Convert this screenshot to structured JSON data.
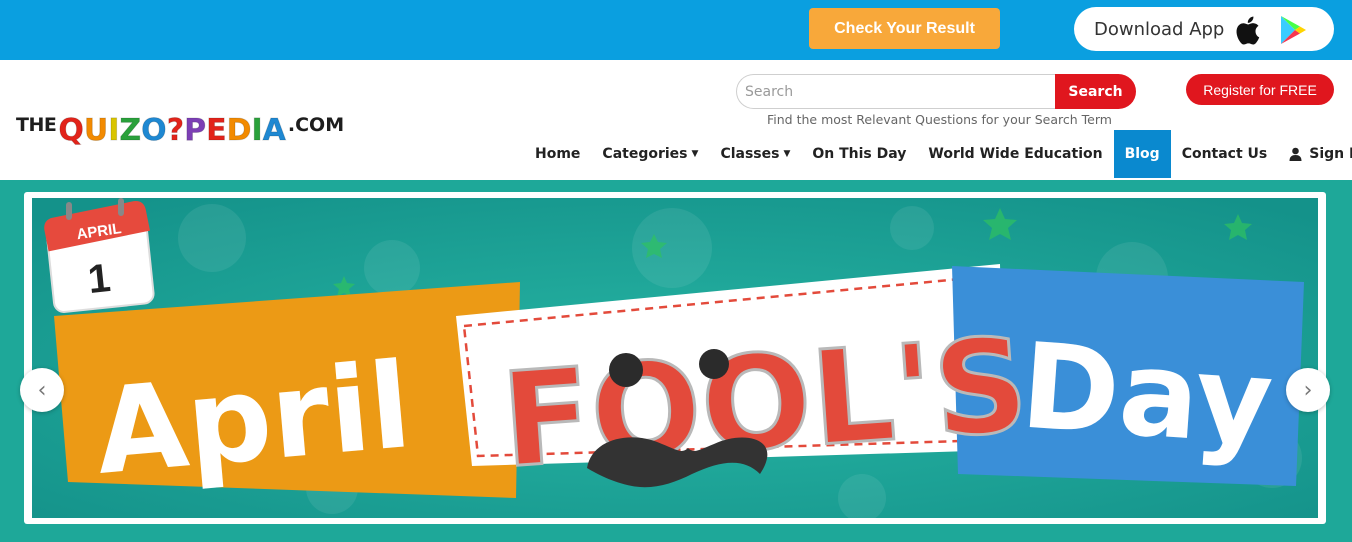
{
  "topbar": {
    "check_result_label": "Check Your Result",
    "download_app_label": "Download App",
    "icons": [
      "apple-icon",
      "google-play-icon"
    ],
    "colors": {
      "bar": "#0a9fe0",
      "check_button": "#f8a83a"
    }
  },
  "header": {
    "logo": {
      "prefix": "THE",
      "letters": [
        "Q",
        "U",
        "I",
        "Z",
        "O",
        "?",
        "P",
        "E",
        "D",
        "I",
        "A"
      ],
      "suffix": ".COM"
    },
    "search": {
      "placeholder": "Search",
      "button_label": "Search",
      "hint": "Find the most Relevant Questions for your Search Term"
    },
    "register_label": "Register for FREE"
  },
  "nav": {
    "items": [
      {
        "label": "Home",
        "dropdown": false
      },
      {
        "label": "Categories",
        "dropdown": true
      },
      {
        "label": "Classes",
        "dropdown": true
      },
      {
        "label": "On This Day",
        "dropdown": false
      },
      {
        "label": "World Wide Education",
        "dropdown": false
      },
      {
        "label": "Blog",
        "dropdown": false,
        "active": true
      },
      {
        "label": "Contact Us",
        "dropdown": false
      },
      {
        "label": "Sign In",
        "dropdown": true,
        "icon": "user-icon"
      }
    ]
  },
  "banner": {
    "calendar_month": "APRIL",
    "calendar_day": "1",
    "word1": "April",
    "word2": "FOOL'S",
    "word3": "Day",
    "prev_symbol": "‹",
    "next_symbol": "›",
    "colors": {
      "background": "#1ea899",
      "orange": "#ec9a15",
      "red": "#e34a3b",
      "blue": "#3a8fd8"
    }
  }
}
